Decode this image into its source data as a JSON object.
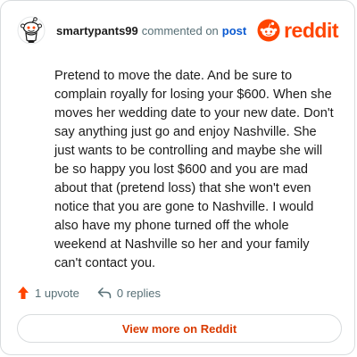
{
  "comment": {
    "username": "smartypants99",
    "action_text": "commented on",
    "post_link": "post",
    "body": "Pretend to move the date. And be sure to complain royally for losing your $600. When she moves her wedding date to your new date. Don't say anything just go and enjoy Nashville. She just wants to be controlling and maybe she will be so happy you lost $600 and you are mad about that (pretend loss) that she won't even notice that you are gone to Nashville. I would also have my phone turned off the whole weekend at Nashville so her and your family can't contact you."
  },
  "brand": {
    "wordmark": "reddit",
    "color": "#ff4500"
  },
  "actions": {
    "upvote_label": "1 upvote",
    "upvote_icon": "upvote-arrow-icon",
    "reply_label": "0 replies",
    "reply_icon": "reply-arrow-icon"
  },
  "cta": {
    "label": "View more on Reddit"
  }
}
